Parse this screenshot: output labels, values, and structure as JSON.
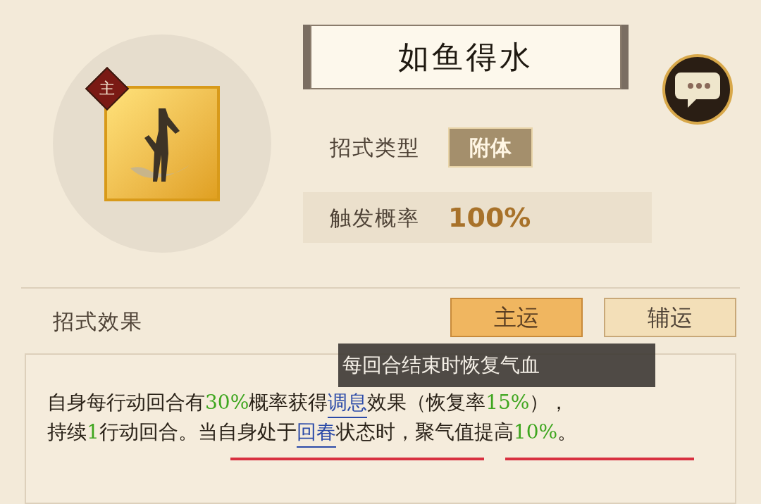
{
  "skill": {
    "badge": "主",
    "name": "如鱼得水"
  },
  "attributes": [
    {
      "label": "招式类型",
      "value": "附体",
      "kind": "tag"
    },
    {
      "label": "触发概率",
      "value": "100%",
      "kind": "number"
    }
  ],
  "effect": {
    "title": "招式效果",
    "tabs": [
      {
        "label": "主运",
        "selected": true
      },
      {
        "label": "辅运",
        "selected": false
      }
    ],
    "tooltip": "每回合结束时恢复气血",
    "lines": [
      [
        {
          "text": "自身每行动回合有",
          "kind": "plain"
        },
        {
          "text": "30%",
          "kind": "value"
        },
        {
          "text": "概率获得",
          "kind": "plain"
        },
        {
          "text": "调息",
          "kind": "link"
        },
        {
          "text": "效果（恢复率",
          "kind": "plain"
        },
        {
          "text": "15%",
          "kind": "value"
        },
        {
          "text": "），",
          "kind": "plain"
        }
      ],
      [
        {
          "text": "持续",
          "kind": "plain"
        },
        {
          "text": "1",
          "kind": "value"
        },
        {
          "text": "行动回合。当自身处于",
          "kind": "plain"
        },
        {
          "text": "回春",
          "kind": "link"
        },
        {
          "text": "状态时，聚气值提高",
          "kind": "plain"
        },
        {
          "text": "10%",
          "kind": "value"
        },
        {
          "text": "。",
          "kind": "plain"
        }
      ]
    ]
  }
}
